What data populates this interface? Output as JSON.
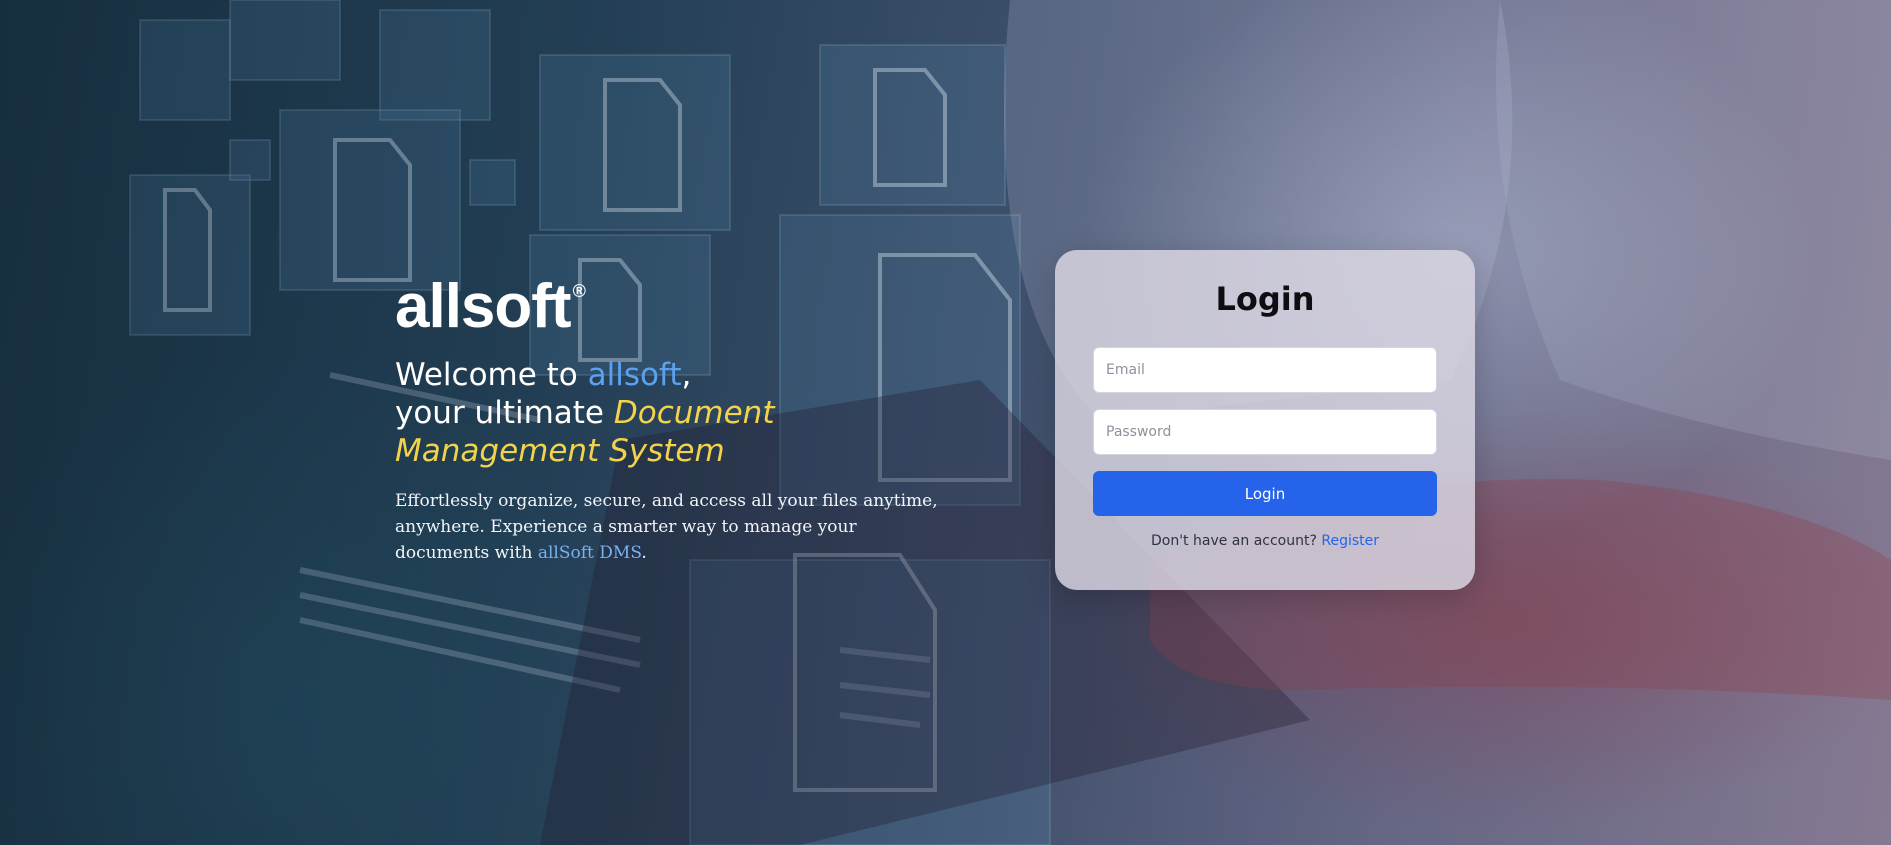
{
  "hero": {
    "logo_text": "allsoft",
    "logo_reg": "®",
    "headline": {
      "welcome_prefix": "Welcome to ",
      "brand": "allsoft",
      "comma": ",",
      "line2_prefix": "your ultimate ",
      "em1": "Document",
      "em2": "Management System"
    },
    "description": {
      "text": "Effortlessly organize, secure, and access all your files anytime, anywhere. Experience a smarter way to manage your documents with ",
      "link": "allSoft DMS",
      "suffix": "."
    }
  },
  "login": {
    "title": "Login",
    "email_placeholder": "Email",
    "password_placeholder": "Password",
    "button_label": "Login",
    "no_account_text": "Don't have an account? ",
    "register_label": "Register"
  },
  "colors": {
    "accent_blue": "#2563eb",
    "brand_blue": "#5aa2f0",
    "highlight_yellow": "#f2d34a"
  }
}
